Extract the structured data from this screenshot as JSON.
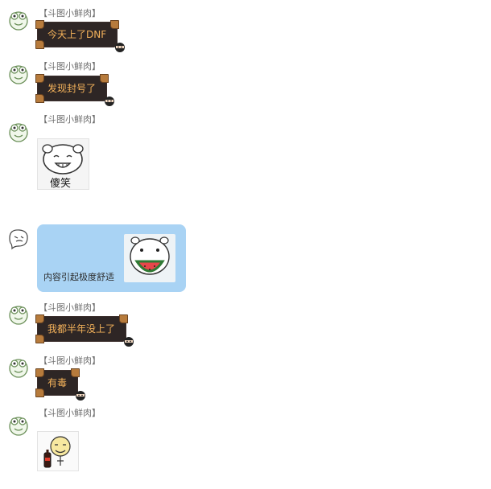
{
  "colors": {
    "bubble_bg": "#2e2625",
    "bubble_text": "#f4b25a",
    "self_bubble_bg": "#a9d3f4",
    "sender_text": "#6f6f6f"
  },
  "messages": [
    {
      "sender": "【斗图小鲜肉】",
      "text": "今天上了DNF"
    },
    {
      "sender": "【斗图小鲜肉】",
      "text": "发现封号了"
    },
    {
      "sender": "【斗图小鲜肉】",
      "sticker_caption": "傻笑"
    },
    {
      "self_text": "内容引起极度舒适"
    },
    {
      "sender": "【斗图小鲜肉】",
      "text": "我都半年没上了"
    },
    {
      "sender": "【斗图小鲜肉】",
      "text": "有毒"
    },
    {
      "sender": "【斗图小鲜肉】",
      "sticker": "cola-sticker"
    }
  ]
}
